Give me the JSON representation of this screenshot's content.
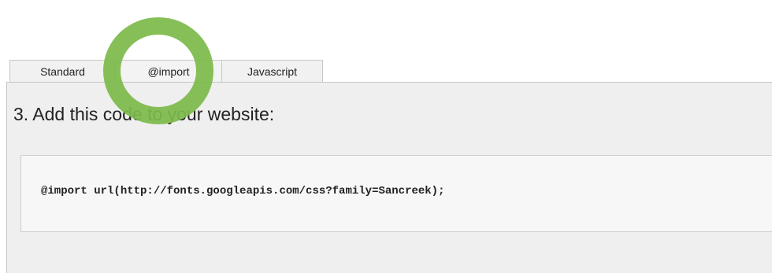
{
  "tabs": [
    {
      "label": "Standard"
    },
    {
      "label": "@import"
    },
    {
      "label": "Javascript"
    }
  ],
  "active_tab": "@import",
  "step_title": "3. Add this code to your website:",
  "code": "@import url(http://fonts.googleapis.com/css?family=Sancreek);",
  "colors": {
    "highlight_ring": "#7dba4a",
    "panel_bg": "#efefef",
    "code_bg": "#f7f7f7",
    "tab_border": "#c6c6c6"
  }
}
